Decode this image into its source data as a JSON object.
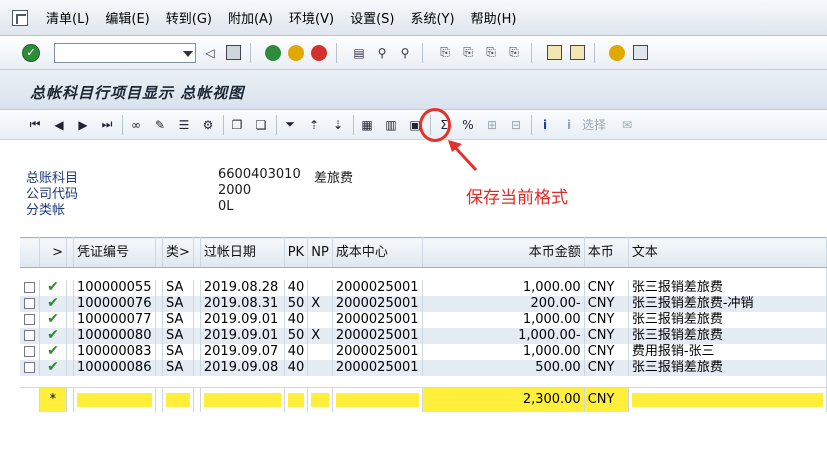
{
  "menu": {
    "items": [
      "清单(L)",
      "编辑(E)",
      "转到(G)",
      "附加(A)",
      "环境(V)",
      "设置(S)",
      "系统(Y)",
      "帮助(H)"
    ]
  },
  "toolbar": {
    "command_value": ""
  },
  "title": "总帐科目行项目显示 总帐视图",
  "app_toolbar": {
    "select_label": "选择"
  },
  "header_info": {
    "account_label": "总账科目",
    "account_value": "6600403010",
    "account_text": "差旅费",
    "company_label": "公司代码",
    "company_value": "2000",
    "ledger_label": "分类帐",
    "ledger_value": "0L"
  },
  "annotation": {
    "text": "保存当前格式",
    "color": "#e02b25"
  },
  "grid": {
    "columns": {
      "status": ">",
      "doc_no": "凭证编号",
      "type": "类>",
      "posting_date": "过帐日期",
      "pk": "PK",
      "np": "NP",
      "cost_center": "成本中心",
      "amount": "本币金额",
      "currency": "本币",
      "text": "文本"
    },
    "rows": [
      {
        "doc_no": "100000055",
        "type": "SA",
        "posting_date": "2019.08.28",
        "pk": "40",
        "np": "",
        "cost_center": "2000025001",
        "amount": "1,000.00",
        "currency": "CNY",
        "text": "张三报销差旅费"
      },
      {
        "doc_no": "100000076",
        "type": "SA",
        "posting_date": "2019.08.31",
        "pk": "50",
        "np": "X",
        "cost_center": "2000025001",
        "amount": "200.00-",
        "currency": "CNY",
        "text": "张三报销差旅费-冲销"
      },
      {
        "doc_no": "100000077",
        "type": "SA",
        "posting_date": "2019.09.01",
        "pk": "40",
        "np": "",
        "cost_center": "2000025001",
        "amount": "1,000.00",
        "currency": "CNY",
        "text": "张三报销差旅费"
      },
      {
        "doc_no": "100000080",
        "type": "SA",
        "posting_date": "2019.09.01",
        "pk": "50",
        "np": "X",
        "cost_center": "2000025001",
        "amount": "1,000.00-",
        "currency": "CNY",
        "text": "张三报销差旅费"
      },
      {
        "doc_no": "100000083",
        "type": "SA",
        "posting_date": "2019.09.07",
        "pk": "40",
        "np": "",
        "cost_center": "2000025001",
        "amount": "1,000.00",
        "currency": "CNY",
        "text": "费用报销-张三"
      },
      {
        "doc_no": "100000086",
        "type": "SA",
        "posting_date": "2019.09.08",
        "pk": "40",
        "np": "",
        "cost_center": "2000025001",
        "amount": "500.00",
        "currency": "CNY",
        "text": "张三报销差旅费"
      }
    ],
    "total": {
      "marker": "*",
      "amount": "2,300.00",
      "currency": "CNY"
    }
  },
  "icons": {
    "ok": "green-check-circle-icon",
    "save": "floppy-disk-icon",
    "back": "back-arrow-icon",
    "exit": "exit-icon",
    "cancel": "cancel-icon",
    "print": "printer-icon",
    "find": "binoculars-icon",
    "help": "help-icon",
    "save_layout": "save-layout-icon"
  },
  "colors": {
    "total_highlight": "#ffef3a",
    "row_alt": "#e4ebf3",
    "check_green": "#2c8a2e"
  }
}
